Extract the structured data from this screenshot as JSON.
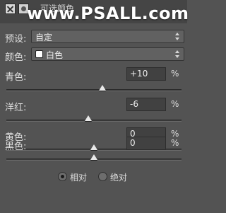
{
  "header": {
    "title": "可选颜色",
    "watermark": "www.PSALL.com"
  },
  "preset": {
    "label": "预设:",
    "value": "自定"
  },
  "colors": {
    "label": "颜色:",
    "value": "白色",
    "swatch_color": "#ffffff"
  },
  "sliders": [
    {
      "label": "青色:",
      "value": "+10",
      "unit": "%"
    },
    {
      "label": "洋红:",
      "value": "-6",
      "unit": "%"
    },
    {
      "label": "黄色:",
      "value": "0",
      "unit": "%"
    },
    {
      "label": "黑色:",
      "value": "0",
      "unit": "%"
    }
  ],
  "method": {
    "options": [
      {
        "label": "相对",
        "selected": true
      },
      {
        "label": "绝对",
        "selected": false
      }
    ]
  }
}
